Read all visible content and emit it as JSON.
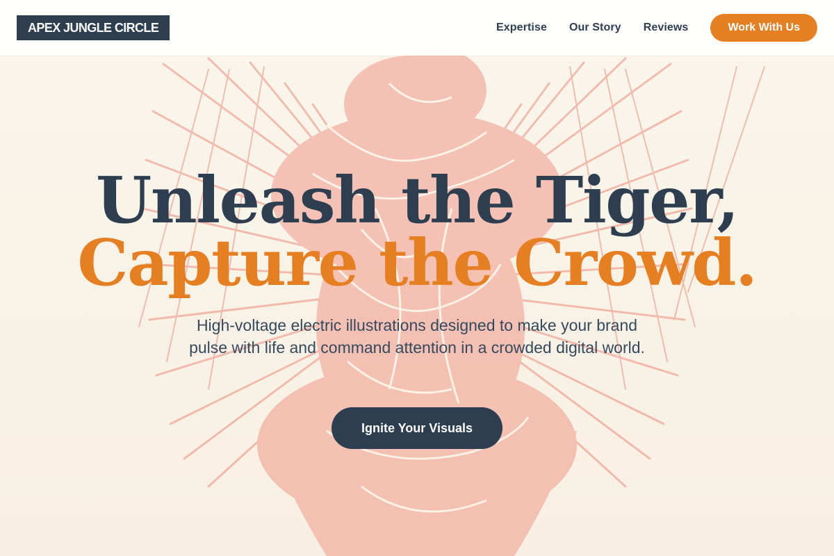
{
  "header": {
    "logo": "APEX JUNGLE CIRCLE",
    "nav": [
      "Expertise",
      "Our Story",
      "Reviews"
    ],
    "cta": "Work With Us"
  },
  "hero": {
    "headline_line1": "Unleash the Tiger,",
    "headline_line2": "Capture the Crowd.",
    "subtitle": "High-voltage electric illustrations designed to make your brand pulse with life and command attention in a crowded digital world.",
    "cta": "Ignite Your Visuals"
  },
  "colors": {
    "navy": "#2c3e50",
    "orange": "#e67e22",
    "background": "#f8f3e7",
    "illustration": "#ef8f80"
  }
}
